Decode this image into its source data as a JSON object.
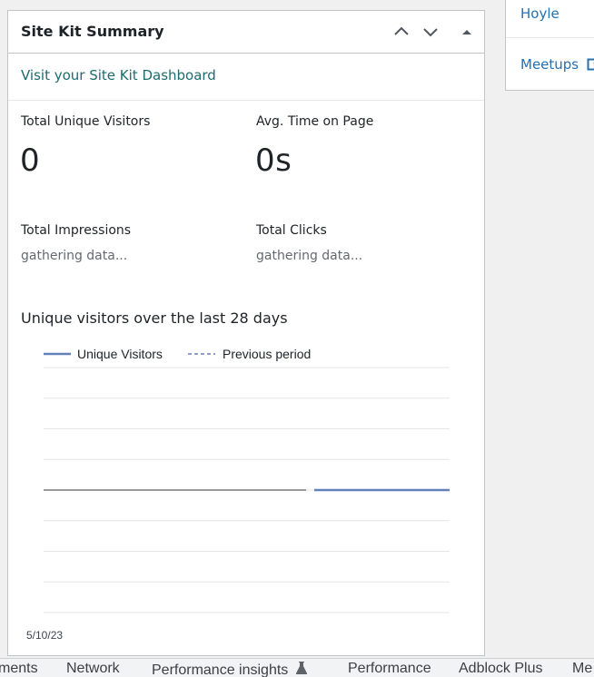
{
  "widget": {
    "title": "Site Kit Summary",
    "dashboard_link": "Visit your Site Kit Dashboard",
    "metrics": [
      {
        "label": "Total Unique Visitors",
        "value": "0"
      },
      {
        "label": "Avg. Time on Page",
        "value": "0s"
      },
      {
        "label": "Total Impressions",
        "value": "gathering data..."
      },
      {
        "label": "Total Clicks",
        "value": "gathering data..."
      }
    ],
    "chart_title": "Unique visitors over the last 28 days"
  },
  "chart_data": {
    "type": "line",
    "title": "Unique visitors over the last 28 days",
    "series": [
      {
        "name": "Unique Visitors",
        "style": "solid",
        "color": "#6380b8",
        "values": [
          0,
          0,
          0,
          0,
          0,
          0,
          0,
          0,
          0,
          0,
          0,
          0,
          0,
          0,
          0,
          0,
          0,
          0,
          0,
          0,
          0,
          0,
          0,
          0,
          0,
          0,
          0,
          0
        ]
      },
      {
        "name": "Previous period",
        "style": "dashed",
        "color": "#6380b8",
        "values": []
      }
    ],
    "x_tick_labels": [
      "5/10/23"
    ],
    "y_tick_labels": [],
    "grid": true,
    "legend_position": "top-left"
  },
  "side_panel": {
    "items": [
      "Hoyle",
      "Meetups"
    ]
  },
  "devtools": {
    "tabs": [
      "ments",
      "Network",
      "Performance insights",
      "Performance",
      "Adblock Plus",
      "Me"
    ]
  },
  "colors": {
    "link_teal": "#1d6b6f",
    "link_blue": "#2271b1",
    "series_blue": "#6380b8"
  }
}
